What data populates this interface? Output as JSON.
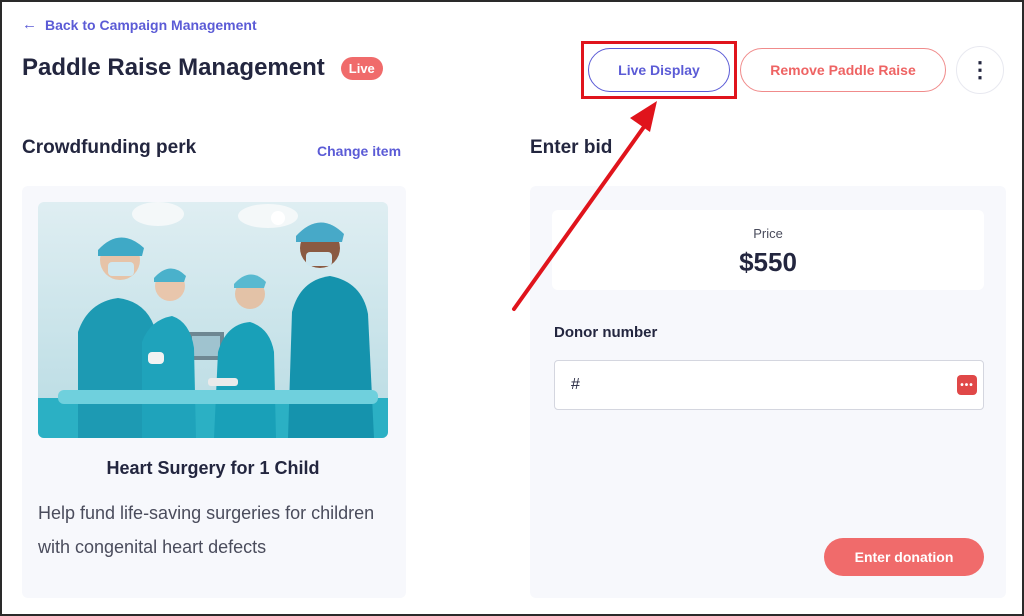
{
  "header": {
    "back_label": "Back to Campaign Management",
    "title": "Paddle Raise Management",
    "status_badge": "Live",
    "live_display_label": "Live Display",
    "remove_label": "Remove Paddle Raise",
    "more_icon": "more-vertical-icon"
  },
  "perk": {
    "heading": "Crowdfunding perk",
    "change_label": "Change item",
    "title": "Heart Surgery for 1 Child",
    "description": "Help fund life-saving surgeries for children with congenital heart defects"
  },
  "bid": {
    "heading": "Enter bid",
    "price_label": "Price",
    "price_value": "$550",
    "donor_label": "Donor number",
    "donor_placeholder": "#",
    "submit_label": "Enter donation"
  },
  "colors": {
    "accent": "#5b5bd6",
    "danger": "#f06b6b",
    "highlight": "#e0141c"
  }
}
